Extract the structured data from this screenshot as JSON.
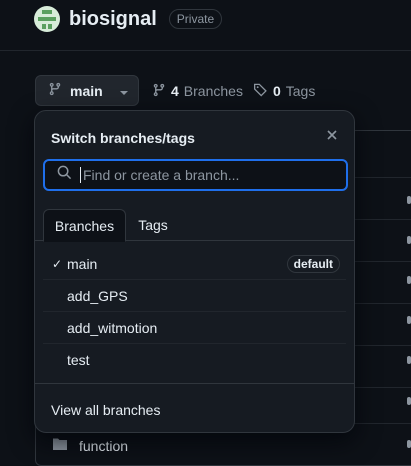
{
  "repo": {
    "name": "biosignal",
    "visibility": "Private"
  },
  "branch_bar": {
    "current_branch": "main",
    "branches_count": "4",
    "branches_label": "Branches",
    "tags_count": "0",
    "tags_label": "Tags"
  },
  "dropdown": {
    "title": "Switch branches/tags",
    "search_placeholder": "Find or create a branch...",
    "tabs": [
      {
        "label": "Branches",
        "active": true
      },
      {
        "label": "Tags",
        "active": false
      }
    ],
    "branches": [
      {
        "name": "main",
        "selected": true,
        "badge": "default"
      },
      {
        "name": "add_GPS",
        "selected": false,
        "badge": ""
      },
      {
        "name": "add_witmotion",
        "selected": false,
        "badge": ""
      },
      {
        "name": "test",
        "selected": false,
        "badge": ""
      }
    ],
    "check_mark": "✓",
    "view_all_label": "View all branches"
  },
  "file_list": {
    "visible_folder": "function"
  },
  "colors": {
    "background": "#0d1117",
    "accent_focus": "#1f6feb",
    "text": "#e6edf3",
    "muted": "#8d96a0"
  }
}
